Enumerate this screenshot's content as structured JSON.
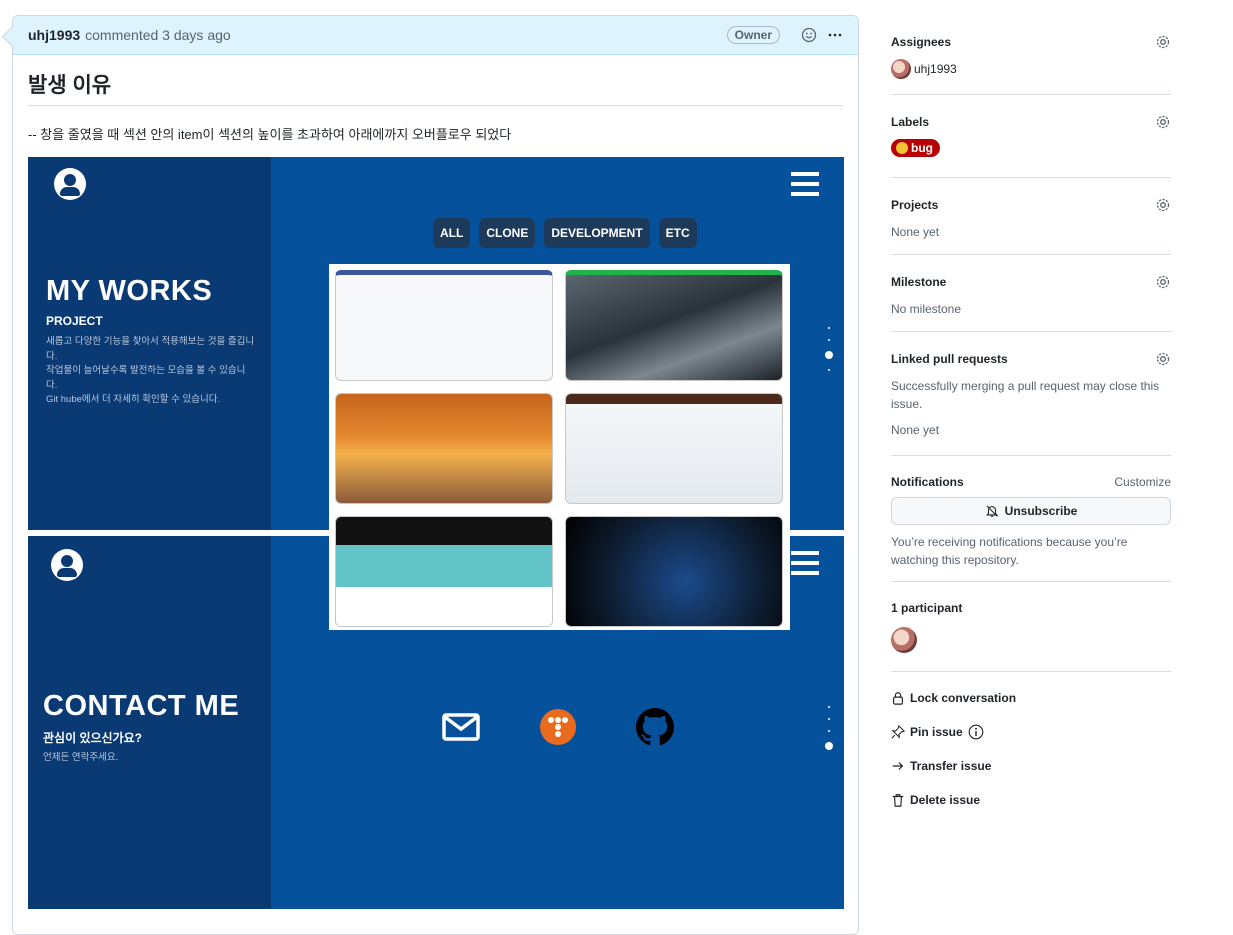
{
  "comment": {
    "author": "uhj1993",
    "meta": "commented 3 days ago",
    "badge": "Owner",
    "title": "발생 이유",
    "text": "-- 창을 줄였을 때 섹션 안의 item이 섹션의 높이를 초과하여 아래에까지 오버플로우 되었다"
  },
  "screenshot": {
    "works_title": "MY WORKS",
    "works_sub": "PROJECT",
    "works_desc": [
      "새롭고 다양한 기능을 찾아서 적용해보는 것을 즐깁니다.",
      "작업물이 늘어날수록 발전하는 모습을 볼 수 있습니다.",
      "Git hube에서 더 자세히 확인할 수 있습니다."
    ],
    "filters": [
      "ALL",
      "CLONE",
      "DEVELOPMENT",
      "ETC"
    ],
    "contact_title": "CONTACT ME",
    "contact_sub": "관심이 있으신가요?",
    "contact_desc": "언제든 연락주세요.",
    "contact_icons": [
      "mail-icon",
      "tistory-icon",
      "github-icon"
    ],
    "colors": {
      "left_panel": "#0a3a74",
      "main": "#05519c"
    }
  },
  "sidebar": {
    "assignees": {
      "title": "Assignees",
      "user": "uhj1993"
    },
    "labels": {
      "title": "Labels",
      "label": "bug",
      "color": "#b60205"
    },
    "projects": {
      "title": "Projects",
      "value": "None yet"
    },
    "milestone": {
      "title": "Milestone",
      "value": "No milestone"
    },
    "linked": {
      "title": "Linked pull requests",
      "desc": "Successfully merging a pull request may close this issue.",
      "value": "None yet"
    },
    "notifications": {
      "title": "Notifications",
      "customize": "Customize",
      "button": "Unsubscribe",
      "desc": "You’re receiving notifications because you’re watching this repository."
    },
    "participants": {
      "title": "1 participant"
    },
    "actions": {
      "lock": "Lock conversation",
      "pin": "Pin issue",
      "transfer": "Transfer issue",
      "delete": "Delete issue"
    }
  }
}
